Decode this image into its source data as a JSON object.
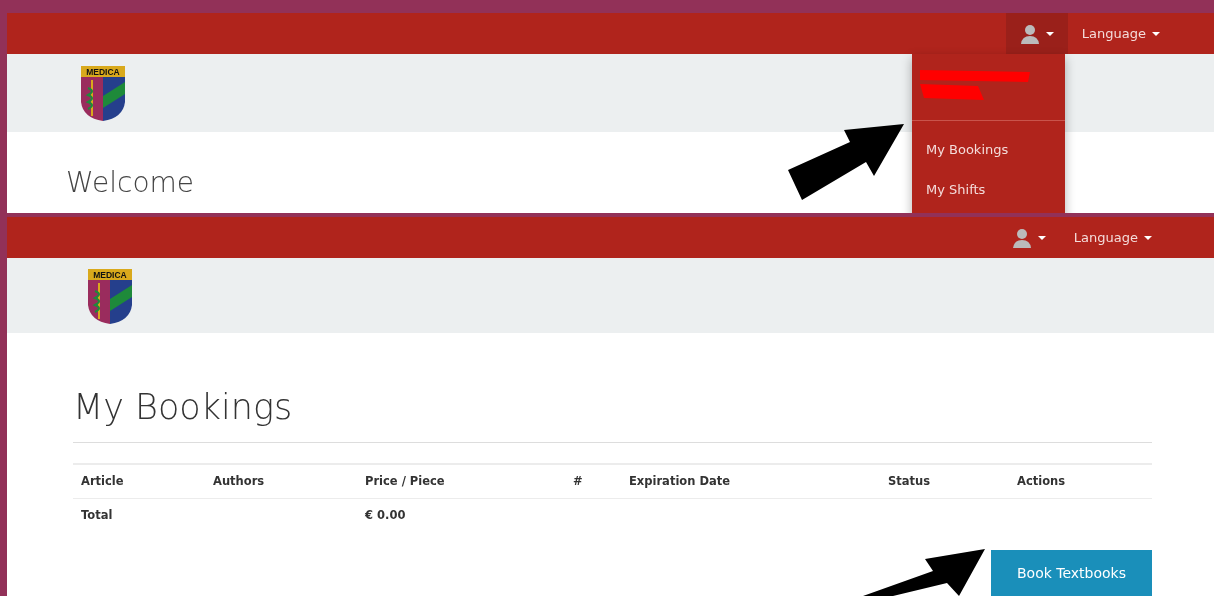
{
  "panels": [
    {
      "navbar": {
        "user_menu": {
          "expanded": true
        },
        "language": "Language"
      },
      "logo": {
        "text": "MEDICA"
      },
      "heading": "Welcome",
      "dropdown": {
        "redacted": true,
        "items": [
          "My Bookings",
          "My Shifts"
        ]
      }
    },
    {
      "navbar": {
        "user_menu": {
          "expanded": false
        },
        "language": "Language"
      },
      "logo": {
        "text": "MEDICA"
      },
      "heading": "My Bookings",
      "table": {
        "columns": [
          "Article",
          "Authors",
          "Price / Piece",
          "#",
          "Expiration Date",
          "Status",
          "Actions"
        ],
        "rows": [
          {
            "label": "Total",
            "price": "€ 0.00"
          }
        ]
      },
      "button": "Book Textbooks"
    }
  ]
}
